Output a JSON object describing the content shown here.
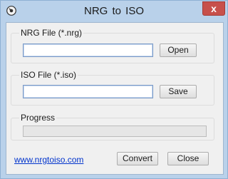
{
  "window": {
    "title": "NRG to  ISO",
    "close_glyph": "x"
  },
  "nrg_group": {
    "label": "NRG File (*.nrg)",
    "value": "",
    "open_label": "Open"
  },
  "iso_group": {
    "label": "ISO File (*.iso)",
    "value": "",
    "save_label": "Save"
  },
  "progress_group": {
    "label": "Progress",
    "value_percent": 0
  },
  "footer": {
    "link_text": "www.nrgtoiso.com",
    "convert_label": "Convert",
    "close_label": "Close"
  },
  "icons": {
    "app": "disc-icon",
    "close": "close-icon"
  },
  "colors": {
    "titlebar": "#b9d1ea",
    "close_button": "#c7504b",
    "link": "#0033cc",
    "progress_fill": "#06b025"
  }
}
